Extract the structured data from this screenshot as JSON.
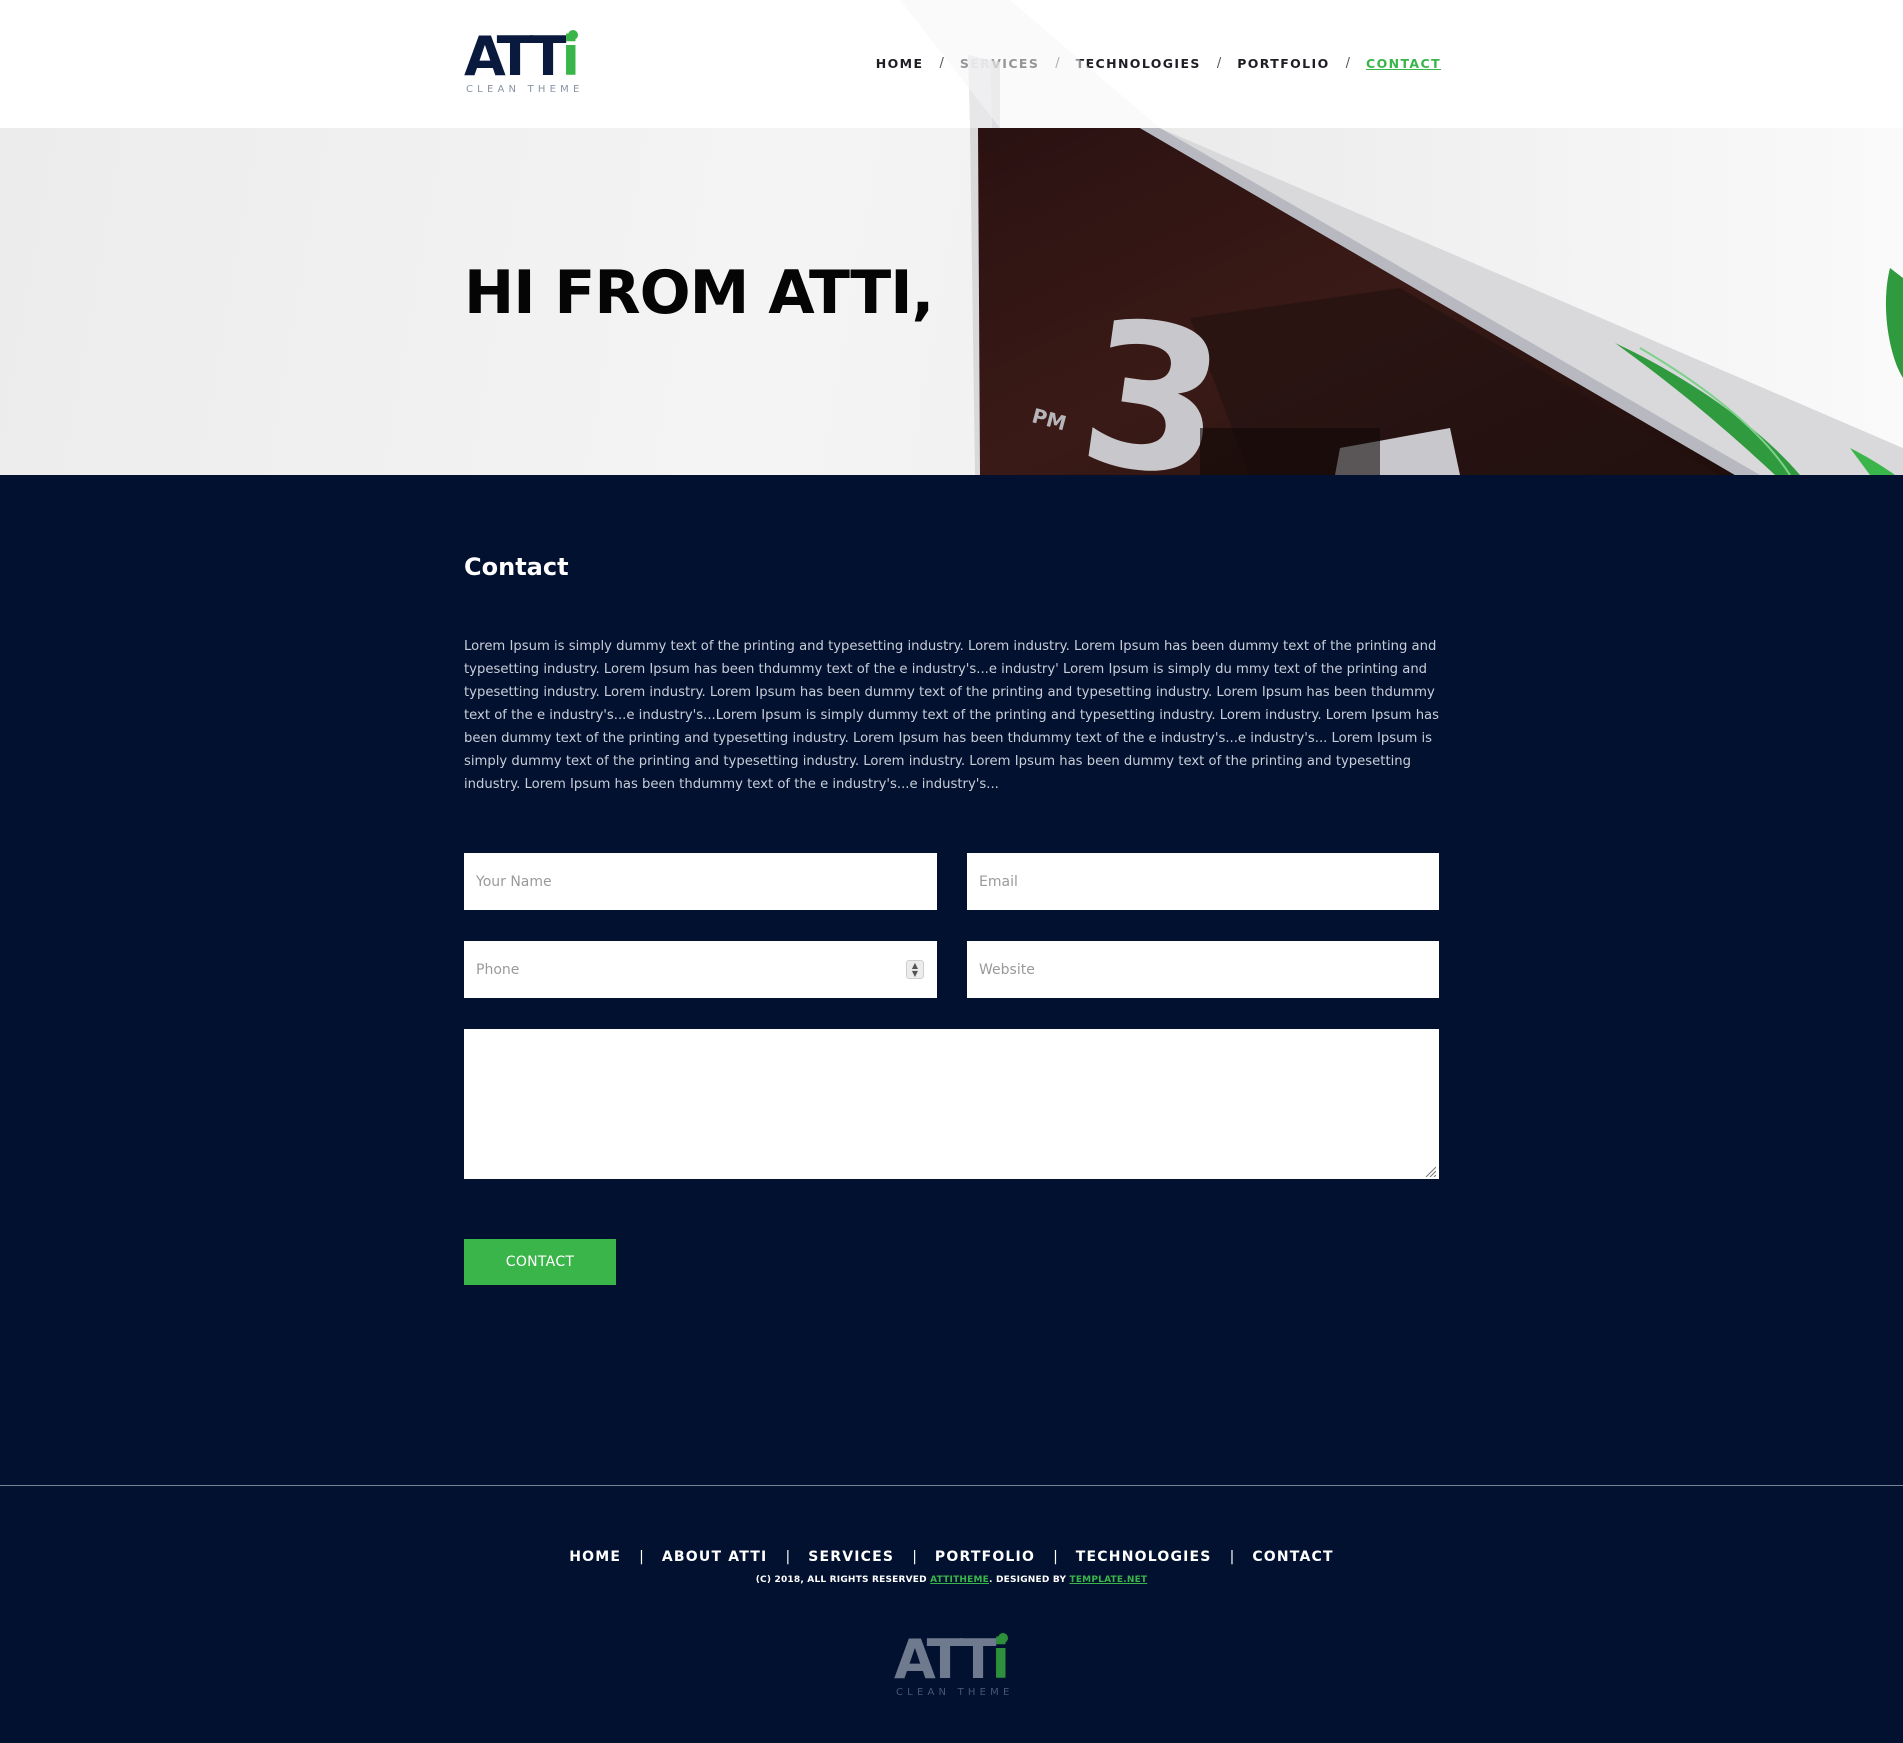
{
  "brand": {
    "logo_main": "ATT",
    "logo_accent": "i",
    "tagline": "CLEAN THEME",
    "accent_color": "#3ab54a",
    "navy_color": "#01112f"
  },
  "nav": {
    "items": [
      {
        "label": "HOME"
      },
      {
        "label": "SERVICES"
      },
      {
        "label": "TECHNOLOGIES"
      },
      {
        "label": "PORTFOLIO"
      },
      {
        "label": "CONTACT",
        "active": true
      }
    ],
    "separator": "/"
  },
  "hero": {
    "title": "HI FROM ATTI,",
    "photo_text_pm": "PM",
    "photo_digit": "3"
  },
  "contact": {
    "title": "Contact",
    "body": "Lorem Ipsum is simply dummy text of the printing and typesetting industry. Lorem industry. Lorem Ipsum has been dummy text of the printing and typesetting industry. Lorem Ipsum has been thdummy text of the e industry's...e industry' Lorem Ipsum is simply du mmy text of the printing and typesetting industry. Lorem industry. Lorem Ipsum has been dummy text of the printing and typesetting industry. Lorem Ipsum has been thdummy text of the e industry's...e industry's...Lorem Ipsum is simply dummy text of the printing and typesetting industry. Lorem industry. Lorem Ipsum has been dummy text of the printing and typesetting industry. Lorem Ipsum has been thdummy text of the e industry's...e industry's... Lorem Ipsum is simply dummy text of the printing and typesetting industry. Lorem industry. Lorem Ipsum has been dummy text of the printing and typesetting industry. Lorem Ipsum has been thdummy text of the e industry's...e industry's...",
    "fields": {
      "name": {
        "placeholder": "Your Name",
        "value": ""
      },
      "email": {
        "placeholder": "Email",
        "value": ""
      },
      "phone": {
        "placeholder": "Phone",
        "value": ""
      },
      "website": {
        "placeholder": "Website",
        "value": ""
      },
      "message": {
        "placeholder": "",
        "value": ""
      }
    },
    "submit_label": "CONTACT"
  },
  "footer": {
    "links": [
      {
        "label": "HOME"
      },
      {
        "label": "ABOUT ATTI"
      },
      {
        "label": "SERVICES"
      },
      {
        "label": "PORTFOLIO"
      },
      {
        "label": "TECHNOLOGIES"
      },
      {
        "label": "CONTACT"
      }
    ],
    "separator": "|",
    "copyright_prefix": "(C) 2018, ALL RIGHTS RESERVED ",
    "copyright_link1": "ATTITHEME",
    "copyright_mid": ". DESIGNED BY ",
    "copyright_link2": "TEMPLATE.NET"
  }
}
